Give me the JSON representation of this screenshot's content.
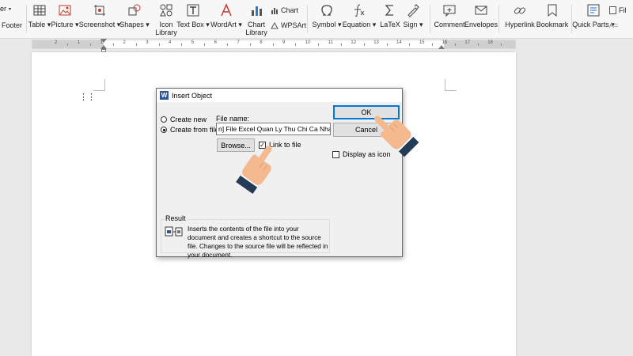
{
  "ribbon": {
    "left_partial_top": "er",
    "left_partial_bottom": "Footer",
    "items": [
      {
        "label": "Table",
        "icon": "table-icon",
        "dropdown": true
      },
      {
        "label": "Picture",
        "icon": "picture-icon",
        "dropdown": true
      },
      {
        "label": "Screenshot",
        "icon": "screenshot-icon",
        "dropdown": true
      },
      {
        "label": "Shapes",
        "icon": "shapes-icon",
        "dropdown": true
      },
      {
        "label": "Icon",
        "label2": "Library",
        "icon": "icon-library-icon"
      },
      {
        "label": "Text Box",
        "icon": "text-box-icon",
        "dropdown": true
      },
      {
        "label": "WordArt",
        "icon": "wordart-icon",
        "dropdown": true
      },
      {
        "label": "Chart",
        "label2": "Library",
        "icon": "chart-library-icon"
      },
      {
        "label": "Symbol",
        "icon": "symbol-icon",
        "dropdown": true
      },
      {
        "label": "Equation",
        "icon": "equation-icon",
        "dropdown": true
      },
      {
        "label": "LaTeX",
        "icon": "latex-icon"
      },
      {
        "label": "Sign",
        "icon": "sign-icon",
        "dropdown": true
      },
      {
        "label": "Comment",
        "icon": "comment-icon"
      },
      {
        "label": "Envelopes",
        "icon": "envelopes-icon"
      },
      {
        "label": "Hyperlink",
        "icon": "hyperlink-icon"
      },
      {
        "label": "Bookmark",
        "icon": "bookmark-icon"
      },
      {
        "label": "Quick Parts",
        "icon": "quick-parts-icon",
        "dropdown": true
      }
    ],
    "chart_small": "Chart",
    "wpsart_small": "WPSArt",
    "right_partial": "Fil",
    "right_partial2": "A="
  },
  "ruler": {
    "numbers": [
      "2",
      "1",
      "1",
      "2",
      "3",
      "4",
      "5",
      "6",
      "7",
      "8",
      "9",
      "10",
      "11",
      "12",
      "13",
      "14",
      "15",
      "16",
      "17",
      "18"
    ]
  },
  "dialog": {
    "title": "Insert Object",
    "logo_letter": "W",
    "options": {
      "create_new": "Create new",
      "create_from_file": "Create from file",
      "selected": "Create from file"
    },
    "file_name_label": "File name:",
    "file_name_value": "n] File Excel Quan Ly Thu Chi Ca Nhan.xlsx",
    "browse_label": "Browse...",
    "link_to_file_label": "Link to file",
    "link_to_file_checked": true,
    "display_as_icon_label": "Display as icon",
    "display_as_icon_checked": false,
    "ok_label": "OK",
    "cancel_label": "Cancel",
    "result_label": "Result",
    "result_text": "Inserts the contents of the file into your document and creates a shortcut to the source file. Changes to the source file will be reflected in your document."
  },
  "colors": {
    "accent": "#0078d7",
    "word_blue": "#2b579a",
    "hand_skin": "#f4b98f",
    "cuff": "#243b55"
  }
}
